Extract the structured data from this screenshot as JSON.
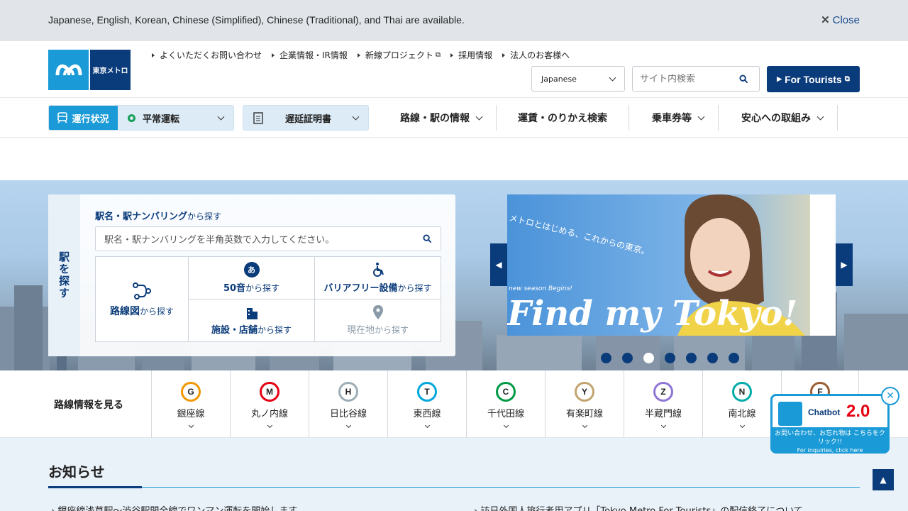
{
  "lang_bar": {
    "message": "Japanese, English, Korean, Chinese (Simplified), Chinese (Traditional), and Thai are available.",
    "close": "Close"
  },
  "header": {
    "logo_text": "東京メトロ",
    "links": [
      "よくいただくお問い合わせ",
      "企業情報・IR情報",
      "新線プロジェクト",
      "採用情報",
      "法人のお客様へ"
    ],
    "language": "Japanese",
    "search_placeholder": "サイト内検索",
    "tourists": "For Tourists"
  },
  "nav": {
    "status_label": "運行状況",
    "status_value": "平常運転",
    "delay_cert": "遅延証明書",
    "menu": [
      "路線・駅の情報",
      "運賃・のりかえ検索",
      "乗車券等",
      "安心への取組み"
    ]
  },
  "station_search": {
    "side": "駅を探す",
    "title": "駅名・駅ナンバリング",
    "title_suffix": "から探す",
    "placeholder": "駅名・駅ナンバリングを半角英数で入力してください。",
    "route_map": "路線図",
    "from": "から探す",
    "gojuon": "50音",
    "barrier_free": "バリアフリー設備",
    "facilities": "施設・店舗",
    "current_location": "現在地"
  },
  "banner": {
    "tagline": "メトロとはじめる、これからの東京。",
    "season": "new season Begins!",
    "headline": "Find my Tokyo!"
  },
  "lines": {
    "heading": "路線情報を見る",
    "items": [
      {
        "code": "G",
        "name": "銀座線",
        "color": "#f39700"
      },
      {
        "code": "M",
        "name": "丸ノ内線",
        "color": "#e60012"
      },
      {
        "code": "H",
        "name": "日比谷線",
        "color": "#9caeb7"
      },
      {
        "code": "T",
        "name": "東西線",
        "color": "#00a7db"
      },
      {
        "code": "C",
        "name": "千代田線",
        "color": "#009944"
      },
      {
        "code": "Y",
        "name": "有楽町線",
        "color": "#c1a470"
      },
      {
        "code": "Z",
        "name": "半蔵門線",
        "color": "#8f76d6"
      },
      {
        "code": "N",
        "name": "南北線",
        "color": "#00ada9"
      },
      {
        "code": "F",
        "name": "",
        "color": "#9c5e31"
      }
    ]
  },
  "news": {
    "heading": "お知らせ",
    "items": [
      "銀座線浅草駅～渋谷駅間全線でワンマン運転を開始します",
      "訪日外国人旅行者用アプリ「Tokyo Metro For Tourists」の配信終了について"
    ]
  },
  "chatbot": {
    "title": "Chatbot",
    "version": "2.0",
    "cta": "お問い合わせ、お忘れ物は こちらをクリック!!",
    "cta_en": "For inquiries, click here"
  }
}
